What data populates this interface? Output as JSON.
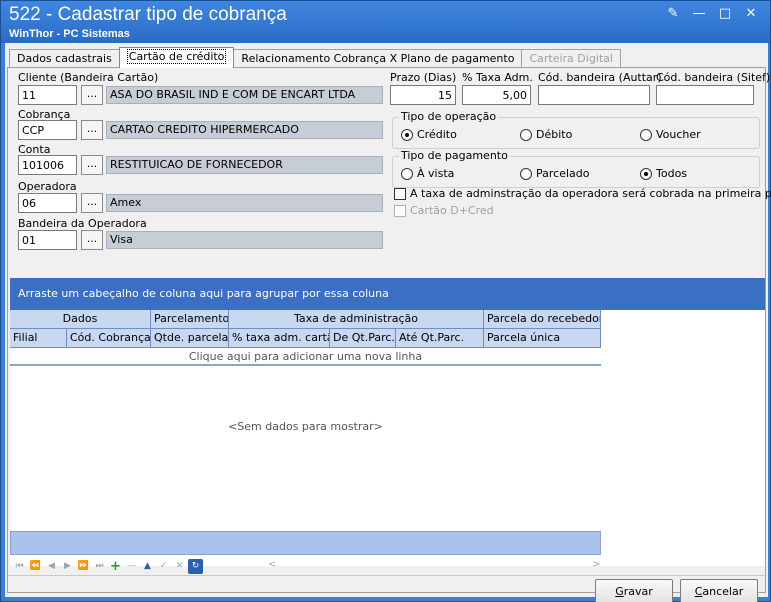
{
  "window": {
    "title": "522 - Cadastrar tipo de cobrança",
    "subtitle": "WinThor - PC Sistemas",
    "controls": [
      "help-icon",
      "minimize-icon",
      "maximize-icon",
      "close-icon"
    ]
  },
  "tabs": [
    {
      "label": "Dados cadastrais",
      "state": "normal"
    },
    {
      "label": "Cartão de crédito",
      "state": "active"
    },
    {
      "label": "Relacionamento Cobrança X Plano de pagamento",
      "state": "normal"
    },
    {
      "label": "Carteira Digital",
      "state": "disabled"
    }
  ],
  "form": {
    "cliente": {
      "label": "Cliente (Bandeira Cartão)",
      "code": "11",
      "button": "...",
      "desc": "ASA DO BRASIL IND E COM DE ENCART LTDA"
    },
    "cobranca": {
      "label": "Cobrança",
      "code": "CCP",
      "button": "...",
      "desc": "CARTAO CREDITO HIPERMERCADO"
    },
    "conta": {
      "label": "Conta",
      "code": "101006",
      "button": "...",
      "desc": "RESTITUICAO DE FORNECEDOR"
    },
    "operadora": {
      "label": "Operadora",
      "code": "06",
      "button": "...",
      "desc": "Amex"
    },
    "bandeira": {
      "label": "Bandeira da Operadora",
      "code": "01",
      "button": "...",
      "desc": "Visa"
    },
    "prazo": {
      "label": "Prazo (Dias)",
      "value": "15"
    },
    "taxa": {
      "label": "% Taxa Adm.",
      "value": "5,00"
    },
    "cod_auttar": {
      "label": "Cód. bandeira (Auttar)",
      "value": ""
    },
    "cod_sitef": {
      "label": "Cód. bandeira (Sitef)",
      "value": ""
    },
    "tipo_operacao": {
      "title": "Tipo de operação",
      "options": [
        {
          "label": "Crédito",
          "selected": true
        },
        {
          "label": "Débito",
          "selected": false
        },
        {
          "label": "Voucher",
          "selected": false
        }
      ]
    },
    "tipo_pagamento": {
      "title": "Tipo de pagamento",
      "options": [
        {
          "label": "À vista",
          "selected": false
        },
        {
          "label": "Parcelado",
          "selected": false
        },
        {
          "label": "Todos",
          "selected": true
        }
      ]
    },
    "chk_taxa": {
      "label": "A taxa de adminstração da operadora será cobrada na primeira parcela",
      "checked": false
    },
    "chk_dcred": {
      "label": "Cartão D+Cred",
      "checked": false,
      "disabled": true
    }
  },
  "grid": {
    "group_panel": "Arraste um cabeçalho de coluna aqui para agrupar por essa coluna",
    "bands": [
      "Dados",
      "Parcelamento",
      "Taxa de administração",
      "Parcela do recebedor"
    ],
    "columns": [
      "Filial",
      "Cód. Cobrança",
      "Qtde. parcelas",
      "% taxa adm. cartão",
      "De Qt.Parc.",
      "Até Qt.Parc.",
      "Parcela única"
    ],
    "new_row": "Clique aqui para adicionar uma nova linha",
    "empty": "<Sem dados para mostrar>",
    "nav_icons": [
      "first-icon",
      "prev-page-icon",
      "prev-icon",
      "next-icon",
      "next-page-icon",
      "last-icon",
      "add-icon",
      "remove-icon",
      "edit-icon",
      "post-icon",
      "cancel-icon",
      "refresh-icon"
    ],
    "scroll_left": "<",
    "scroll_right": ">"
  },
  "buttons": {
    "save": {
      "prefix": "",
      "accel": "G",
      "rest": "ravar"
    },
    "cancel": {
      "prefix": "",
      "accel": "C",
      "rest": "ancelar"
    }
  }
}
